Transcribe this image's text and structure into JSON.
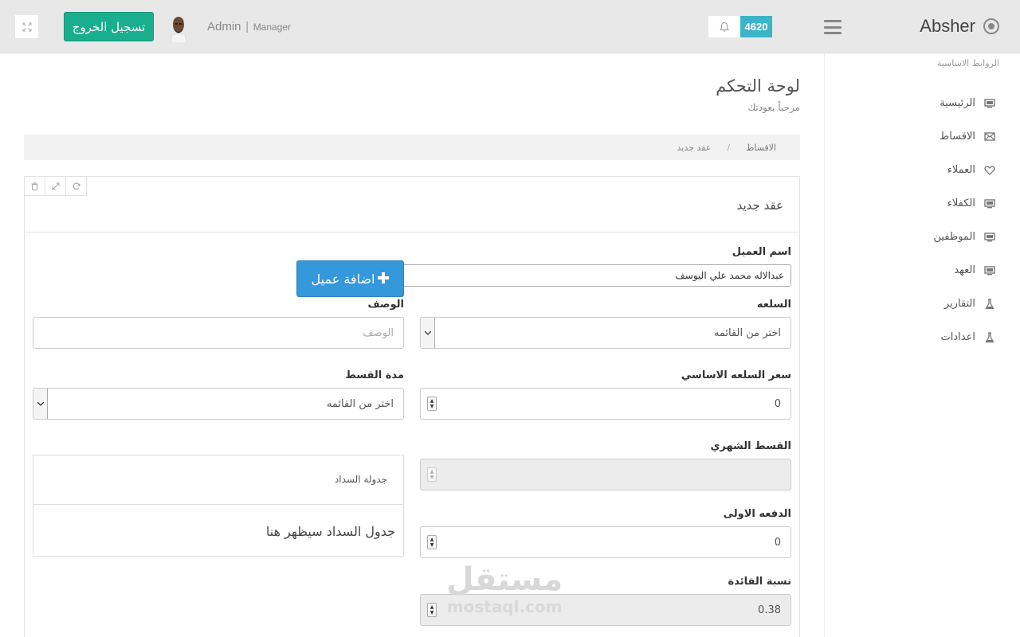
{
  "header": {
    "brand_name": "Absher",
    "notification_count": "4620",
    "user_name": "Admin",
    "user_separator": "|",
    "user_role": "Manager",
    "logout_label": "تسجيل الخروج"
  },
  "sidebar": {
    "heading": "الروابط الاساسية",
    "items": [
      {
        "label": "الرئيسية",
        "icon": "monitor-icon"
      },
      {
        "label": "الاقساط",
        "icon": "envelope-icon"
      },
      {
        "label": "العملاء",
        "icon": "heart-icon"
      },
      {
        "label": "الكفلاء",
        "icon": "monitor-icon"
      },
      {
        "label": "الموظفين",
        "icon": "monitor-icon"
      },
      {
        "label": "العهد",
        "icon": "monitor-icon"
      },
      {
        "label": "التقارير",
        "icon": "flask-icon"
      },
      {
        "label": "اعدادات",
        "icon": "flask-icon"
      }
    ]
  },
  "page": {
    "title": "لوحة التحكم",
    "subtitle": "مرحباً بعودتك"
  },
  "breadcrumb": {
    "link": "الاقساط",
    "separator": "/",
    "current": "عقد جديد"
  },
  "panel": {
    "title": "عقد جديد"
  },
  "form": {
    "client_label": "اسم العميل",
    "client_value": "عبدالاله محمد علي اليوسف",
    "add_client_label": "اضافة عميل",
    "product_label": "السلعه",
    "product_value": "اختر من القائمه",
    "description_label": "الوصف",
    "description_placeholder": "الوصف",
    "base_price_label": "سعر السلعه الاساسي",
    "base_price_value": "0",
    "installment_period_label": "مدة القسط",
    "installment_period_value": "اختر من القائمه",
    "monthly_installment_label": "القسط الشهري",
    "monthly_installment_value": "",
    "first_payment_label": "الدفعه الاولى",
    "first_payment_value": "0",
    "interest_rate_label": "نسبة الفائدة",
    "interest_rate_value": "0.38"
  },
  "schedule": {
    "heading": "جدولة السداد",
    "placeholder": "جدول السداد سيظهر هنا"
  },
  "watermark": {
    "arabic": "مستقل",
    "latin": "mostaql.com"
  },
  "colors": {
    "logout_button": "#1aae8e",
    "add_button": "#3498db",
    "notification_badge": "#3bb4c8",
    "header_bg": "#e8e8e8"
  }
}
